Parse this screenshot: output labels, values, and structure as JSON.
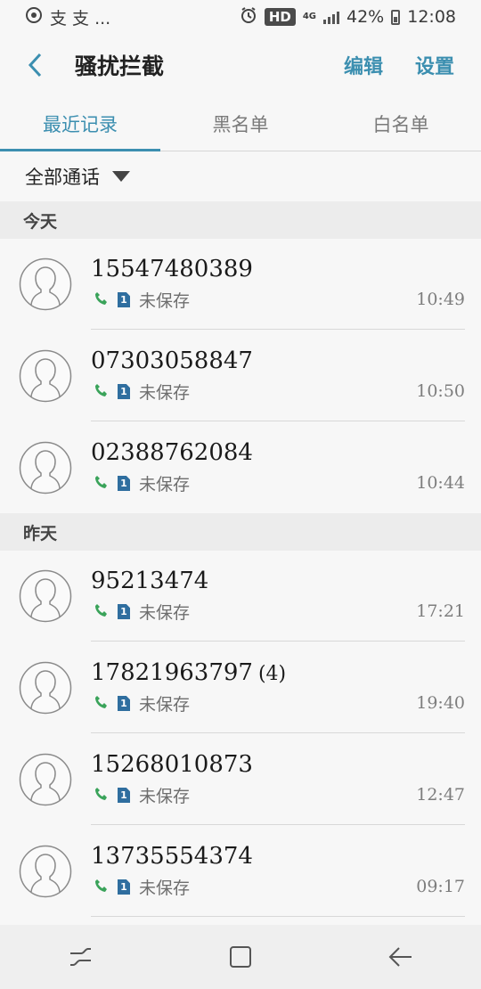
{
  "status_bar": {
    "left_text": "支 支 ...",
    "hd": "HD",
    "net": "4G",
    "battery": "42%",
    "time": "12:08"
  },
  "header": {
    "title": "骚扰拦截",
    "edit": "编辑",
    "settings": "设置"
  },
  "tabs": [
    {
      "label": "最近记录",
      "active": true
    },
    {
      "label": "黑名单",
      "active": false
    },
    {
      "label": "白名单",
      "active": false
    }
  ],
  "filter": {
    "label": "全部通话"
  },
  "sections": [
    {
      "title": "今天",
      "calls": [
        {
          "number": "15547480389",
          "count": "",
          "sim": "1",
          "status": "未保存",
          "time": "10:49"
        },
        {
          "number": "07303058847",
          "count": "",
          "sim": "1",
          "status": "未保存",
          "time": "10:50"
        },
        {
          "number": "02388762084",
          "count": "",
          "sim": "1",
          "status": "未保存",
          "time": "10:44"
        }
      ]
    },
    {
      "title": "昨天",
      "calls": [
        {
          "number": "95213474",
          "count": "",
          "sim": "1",
          "status": "未保存",
          "time": "17:21"
        },
        {
          "number": "17821963797",
          "count": "(4)",
          "sim": "1",
          "status": "未保存",
          "time": "19:40"
        },
        {
          "number": "15268010873",
          "count": "",
          "sim": "1",
          "status": "未保存",
          "time": "12:47"
        },
        {
          "number": "13735554374",
          "count": "",
          "sim": "1",
          "status": "未保存",
          "time": "09:17"
        }
      ]
    }
  ],
  "colors": {
    "accent": "#3c8fb0",
    "phone_icon": "#3aa35a",
    "sim_icon": "#2f6e9f"
  }
}
